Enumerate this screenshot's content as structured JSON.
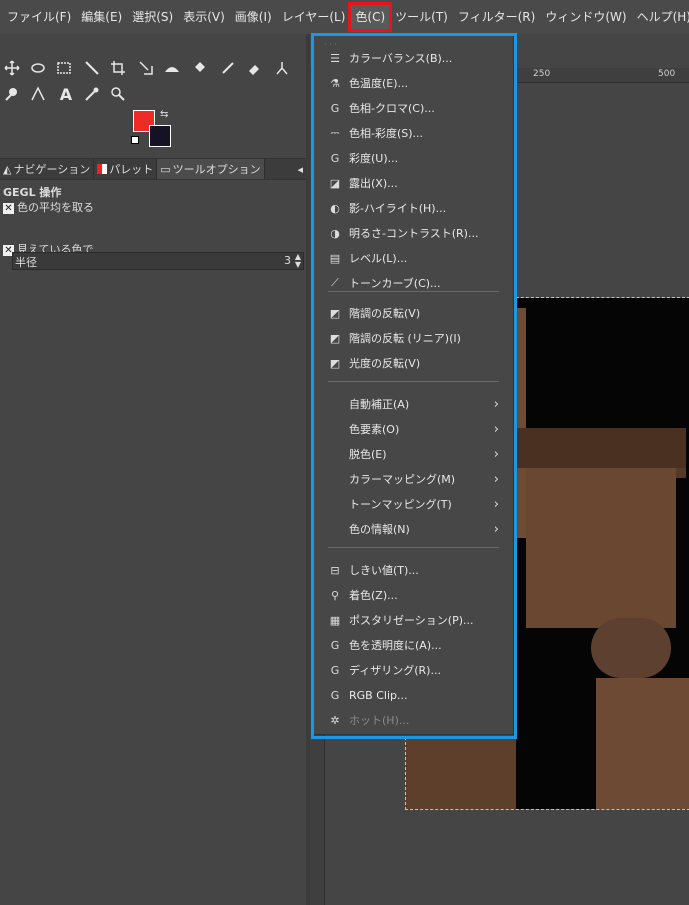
{
  "menubar": [
    "ファイル(F)",
    "編集(E)",
    "選択(S)",
    "表示(V)",
    "画像(I)",
    "レイヤー(L)",
    "色(C)",
    "ツール(T)",
    "フィルター(R)",
    "ウィンドウ(W)",
    "ヘルプ(H)"
  ],
  "tabs": {
    "navigation": "ナビゲーション",
    "palette": "パレット",
    "tool_options": "ツールオプション"
  },
  "tool_options": {
    "title": "GEGL 操作",
    "average_label": "色の平均を取る",
    "radius_label": "半径",
    "radius_value": "3",
    "visible_label": "見えている色で"
  },
  "ruler": {
    "top": [
      "250",
      "500"
    ]
  },
  "color_menu": {
    "group1": [
      {
        "label": "カラーバランス(B)...",
        "icon": "balance-icon"
      },
      {
        "label": "色温度(E)...",
        "icon": "temperature-icon"
      },
      {
        "label": "色相-クロマ(C)...",
        "icon": "gegl-icon"
      },
      {
        "label": "色相-彩度(S)...",
        "icon": "hue-sat-icon"
      },
      {
        "label": "彩度(U)...",
        "icon": "gegl-icon"
      },
      {
        "label": "露出(X)...",
        "icon": "exposure-icon"
      },
      {
        "label": "影-ハイライト(H)...",
        "icon": "shadows-icon"
      },
      {
        "label": "明るさ-コントラスト(R)...",
        "icon": "brightness-icon"
      },
      {
        "label": "レベル(L)...",
        "icon": "levels-icon"
      },
      {
        "label": "トーンカーブ(C)...",
        "icon": "curves-icon"
      }
    ],
    "group2": [
      {
        "label": "階調の反転(V)",
        "icon": "invert-icon"
      },
      {
        "label": "階調の反転 (リニア)(I)",
        "icon": "invert-icon"
      },
      {
        "label": "光度の反転(V)",
        "icon": "invert-icon"
      }
    ],
    "group3": [
      {
        "label": "自動補正(A)"
      },
      {
        "label": "色要素(O)"
      },
      {
        "label": "脱色(E)"
      },
      {
        "label": "カラーマッピング(M)"
      },
      {
        "label": "トーンマッピング(T)"
      },
      {
        "label": "色の情報(N)"
      }
    ],
    "group4": [
      {
        "label": "しきい値(T)...",
        "icon": "threshold-icon"
      },
      {
        "label": "着色(Z)...",
        "icon": "colorize-icon"
      },
      {
        "label": "ポスタリゼーション(P)...",
        "icon": "posterize-icon"
      },
      {
        "label": "色を透明度に(A)...",
        "icon": "gegl-icon"
      },
      {
        "label": "ディザリング(R)...",
        "icon": "gegl-icon"
      },
      {
        "label": "RGB Clip...",
        "icon": "gegl-icon"
      },
      {
        "label": "ホット(H)...",
        "icon": "hot-icon",
        "disabled": true
      }
    ]
  }
}
